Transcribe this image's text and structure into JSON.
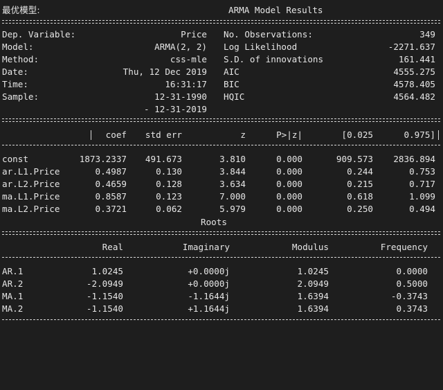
{
  "prefix": "最优模型:",
  "title": "ARMA Model Results",
  "summary_left": [
    {
      "label": "Dep. Variable:",
      "value": "Price"
    },
    {
      "label": "Model:",
      "value": "ARMA(2, 2)"
    },
    {
      "label": "Method:",
      "value": "css-mle"
    },
    {
      "label": "Date:",
      "value": "Thu, 12 Dec 2019"
    },
    {
      "label": "Time:",
      "value": "16:31:17"
    },
    {
      "label": "Sample:",
      "value": "12-31-1990"
    },
    {
      "label": "",
      "value": "- 12-31-2019"
    }
  ],
  "summary_right": [
    {
      "label": "No. Observations:",
      "value": "349"
    },
    {
      "label": "Log Likelihood",
      "value": "-2271.637"
    },
    {
      "label": "S.D. of innovations",
      "value": "161.441"
    },
    {
      "label": "AIC",
      "value": "4555.275"
    },
    {
      "label": "BIC",
      "value": "4578.405"
    },
    {
      "label": "HQIC",
      "value": "4564.482"
    }
  ],
  "coef_table": {
    "headers": [
      "coef",
      "std err",
      "z",
      "P>|z|",
      "[0.025",
      "0.975]"
    ],
    "rows": [
      [
        "const",
        "1873.2337",
        "491.673",
        "3.810",
        "0.000",
        "909.573",
        "2836.894"
      ],
      [
        "ar.L1.Price",
        "0.4987",
        "0.130",
        "3.844",
        "0.000",
        "0.244",
        "0.753"
      ],
      [
        "ar.L2.Price",
        "0.4659",
        "0.128",
        "3.634",
        "0.000",
        "0.215",
        "0.717"
      ],
      [
        "ma.L1.Price",
        "0.8587",
        "0.123",
        "7.000",
        "0.000",
        "0.618",
        "1.099"
      ],
      [
        "ma.L2.Price",
        "0.3721",
        "0.062",
        "5.979",
        "0.000",
        "0.250",
        "0.494"
      ]
    ]
  },
  "roots": {
    "title": "Roots",
    "headers": [
      "Real",
      "Imaginary",
      "Modulus",
      "Frequency"
    ],
    "rows": [
      [
        "AR.1",
        "1.0245",
        "+0.0000j",
        "1.0245",
        "0.0000"
      ],
      [
        "AR.2",
        "-2.0949",
        "+0.0000j",
        "2.0949",
        "0.5000"
      ],
      [
        "MA.1",
        "-1.1540",
        "-1.1644j",
        "1.6394",
        "-0.3743"
      ],
      [
        "MA.2",
        "-1.1540",
        "+1.1644j",
        "1.6394",
        "0.3743"
      ]
    ]
  }
}
